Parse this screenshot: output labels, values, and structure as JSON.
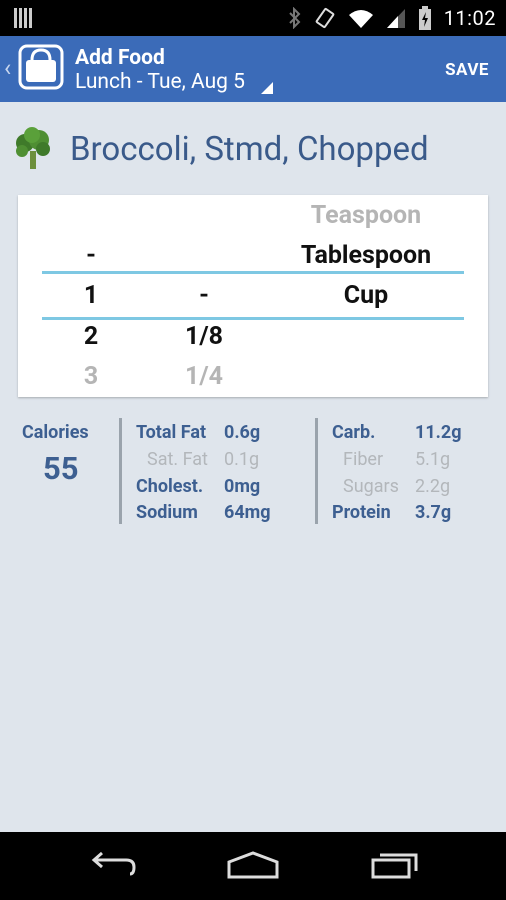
{
  "status_bar": {
    "time": "11:02"
  },
  "action_bar": {
    "title": "Add Food",
    "subtitle": "Lunch - Tue, Aug 5",
    "save_label": "SAVE"
  },
  "food": {
    "name": "Broccoli, Stmd, Chopped",
    "icon": "broccoli-icon"
  },
  "picker": {
    "whole_column": {
      "above2": "",
      "above1": "-",
      "selected": "1",
      "below1": "2",
      "below2": "3"
    },
    "fraction_column": {
      "above2": "",
      "above1": "",
      "selected": "-",
      "below1": "1/8",
      "below2": "1/4"
    },
    "unit_column": {
      "above2": "Teaspoon",
      "above1": "Tablespoon",
      "selected": "Cup",
      "below1": "",
      "below2": ""
    },
    "accent_color": "#7ec8e3"
  },
  "nutrition": {
    "calories_label": "Calories",
    "calories_value": "55",
    "total_fat_label": "Total Fat",
    "total_fat_value": "0.6g",
    "sat_fat_label": "Sat. Fat",
    "sat_fat_value": "0.1g",
    "cholesterol_label": "Cholest.",
    "cholesterol_value": "0mg",
    "sodium_label": "Sodium",
    "sodium_value": "64mg",
    "carb_label": "Carb.",
    "carb_value": "11.2g",
    "fiber_label": "Fiber",
    "fiber_value": "5.1g",
    "sugars_label": "Sugars",
    "sugars_value": "2.2g",
    "protein_label": "Protein",
    "protein_value": "3.7g"
  },
  "colors": {
    "action_bar": "#3b6bb8",
    "background": "#dfe5ec",
    "label": "#3d5f91"
  }
}
